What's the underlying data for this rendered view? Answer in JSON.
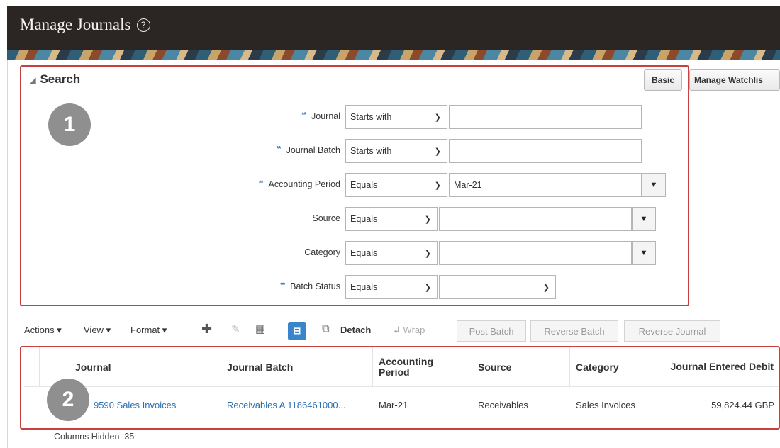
{
  "header": {
    "title": "Manage Journals",
    "help_icon": "?"
  },
  "search": {
    "title": "Search",
    "basic_button": "Basic",
    "watchlist_button": "Manage Watchlis",
    "required_marker": "**",
    "fields": [
      {
        "label": "Journal",
        "operator": "Starts with",
        "value": ""
      },
      {
        "label": "Journal Batch",
        "operator": "Starts with",
        "value": ""
      },
      {
        "label": "Accounting Period",
        "operator": "Equals",
        "value": "Mar-21"
      },
      {
        "label": "Source",
        "operator": "Equals",
        "value": ""
      },
      {
        "label": "Category",
        "operator": "Equals",
        "value": ""
      },
      {
        "label": "Batch Status",
        "operator": "Equals",
        "value": ""
      }
    ]
  },
  "callouts": {
    "one": "1",
    "two": "2"
  },
  "toolbar": {
    "actions": "Actions",
    "view": "View",
    "format": "Format",
    "detach": "Detach",
    "wrap": "Wrap",
    "post_batch": "Post Batch",
    "reverse_batch": "Reverse Batch",
    "reverse_journal": "Reverse Journal"
  },
  "table": {
    "columns": [
      "Journal",
      "Journal Batch",
      "Accounting Period",
      "Source",
      "Category",
      "Journal Entered Debit"
    ],
    "rows": [
      [
        "9590 Sales Invoices",
        "Receivables A 1186461000...",
        "Mar-21",
        "Receivables",
        "Sales Invoices",
        "59,824.44 GBP"
      ]
    ],
    "columns_hidden_label": "Columns Hidden",
    "columns_hidden_count": "35"
  },
  "colors": {
    "accent": "#c9413f",
    "link": "#2a6fb0",
    "header_bg": "#2b2623",
    "callout": "#8f8f8f"
  }
}
